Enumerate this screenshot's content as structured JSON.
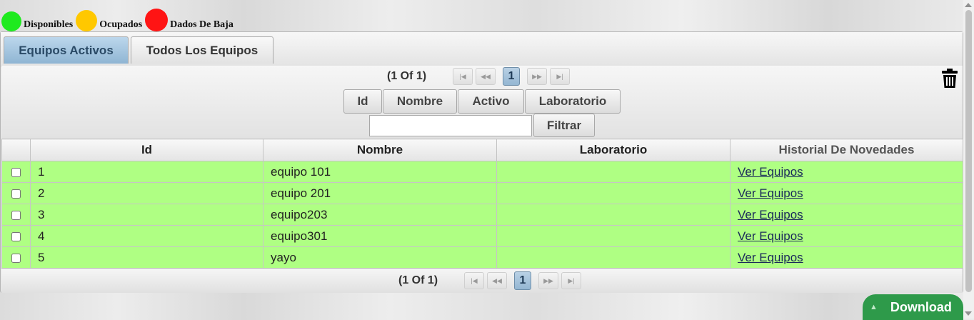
{
  "legend": [
    {
      "label": "Disponibles",
      "color": "#1eea1e"
    },
    {
      "label": "Ocupados",
      "color": "#ffc800"
    },
    {
      "label": "Dados De Baja",
      "color": "#ff1414"
    }
  ],
  "tabs": [
    {
      "label": "Equipos Activos",
      "active": true
    },
    {
      "label": "Todos Los Equipos",
      "active": false
    }
  ],
  "paginator": {
    "current_report": "(1 Of 1)",
    "page": "1",
    "first_icon": "first-page-icon",
    "prev_icon": "prev-page-icon",
    "next_icon": "next-page-icon",
    "last_icon": "last-page-icon"
  },
  "column_toggles": [
    "Id",
    "Nombre",
    "Activo",
    "Laboratorio"
  ],
  "filter": {
    "value": "",
    "button_label": "Filtrar"
  },
  "table": {
    "headers": [
      "Id",
      "Nombre",
      "Laboratorio",
      "Historial De Novedades"
    ],
    "rows": [
      {
        "id": "1",
        "nombre": "equipo 101",
        "laboratorio": "",
        "link": "Ver Equipos"
      },
      {
        "id": "2",
        "nombre": "equipo 201",
        "laboratorio": "",
        "link": "Ver Equipos"
      },
      {
        "id": "3",
        "nombre": "equipo203",
        "laboratorio": "",
        "link": "Ver Equipos"
      },
      {
        "id": "4",
        "nombre": "equipo301",
        "laboratorio": "",
        "link": "Ver Equipos"
      },
      {
        "id": "5",
        "nombre": "yayo",
        "laboratorio": "",
        "link": "Ver Equipos"
      }
    ],
    "row_color": "#afff83"
  },
  "download": {
    "label": "Download",
    "icon": "chevron-up-icon"
  }
}
